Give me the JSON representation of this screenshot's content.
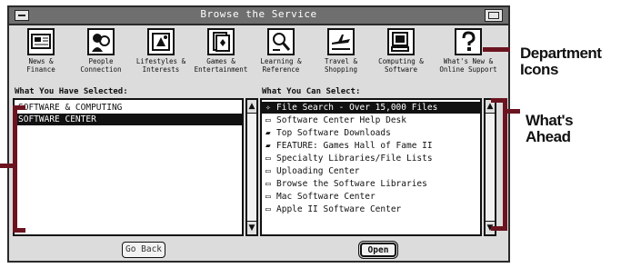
{
  "window": {
    "title": "Browse the Service"
  },
  "departments": [
    {
      "label": "News &\nFinance",
      "icon": "news-finance-icon"
    },
    {
      "label": "People\nConnection",
      "icon": "people-connection-icon"
    },
    {
      "label": "Lifestyles &\nInterests",
      "icon": "lifestyles-interests-icon"
    },
    {
      "label": "Games &\nEntertainment",
      "icon": "games-entertainment-icon"
    },
    {
      "label": "Learning &\nReference",
      "icon": "learning-reference-icon"
    },
    {
      "label": "Travel &\nShopping",
      "icon": "travel-shopping-icon"
    },
    {
      "label": "Computing &\nSoftware",
      "icon": "computing-software-icon"
    },
    {
      "label": "What's New &\nOnline Support",
      "icon": "whats-new-support-icon"
    }
  ],
  "selected_panel": {
    "heading": "What You Have Selected:",
    "items": [
      {
        "label": "SOFTWARE & COMPUTING",
        "selected": false
      },
      {
        "label": "SOFTWARE CENTER",
        "selected": true
      }
    ]
  },
  "select_panel": {
    "heading": "What You Can Select:",
    "items": [
      {
        "icon": "search-icon",
        "glyph": "✧",
        "label": "File Search - Over 15,000 Files",
        "selected": true
      },
      {
        "icon": "folder-icon",
        "glyph": "▭",
        "label": "Software Center Help Desk",
        "selected": false
      },
      {
        "icon": "document-icon",
        "glyph": "▰",
        "label": "Top Software Downloads",
        "selected": false
      },
      {
        "icon": "document-icon",
        "glyph": "▰",
        "label": "FEATURE: Games Hall of Fame II",
        "selected": false
      },
      {
        "icon": "folder-icon",
        "glyph": "▭",
        "label": "Specialty Libraries/File Lists",
        "selected": false
      },
      {
        "icon": "folder-icon",
        "glyph": "▭",
        "label": "Uploading Center",
        "selected": false
      },
      {
        "icon": "folder-icon",
        "glyph": "▭",
        "label": "Browse the Software Libraries",
        "selected": false
      },
      {
        "icon": "folder-icon",
        "glyph": "▭",
        "label": "Mac Software Center",
        "selected": false
      },
      {
        "icon": "folder-icon",
        "glyph": "▭",
        "label": "Apple II Software Center",
        "selected": false
      }
    ]
  },
  "buttons": {
    "go_back": "Go Back",
    "open": "Open"
  },
  "callouts": {
    "department_icons": "Department\nIcons",
    "whats_ahead": "What's\nAhead"
  },
  "colors": {
    "accent": "#6b1420",
    "window_bg": "#dcdcdc",
    "titlebar": "#6f6f6f"
  }
}
